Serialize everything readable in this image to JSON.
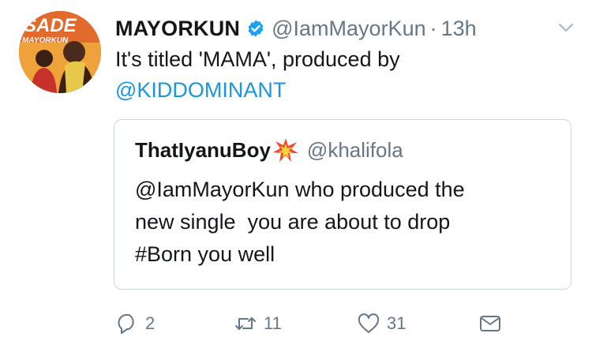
{
  "tweet": {
    "author_name": "MAYORKUN",
    "author_handle": "@IamMayorKun",
    "time": "13h",
    "text_before": "It's titled 'MAMA', produced by",
    "mention": "@KIDDOMINANT"
  },
  "quoted_tweet": {
    "author_name": "ThatIyanuBoy",
    "author_handle": "@khalifola",
    "text": "@IamMayorKun who produced the\nnew single  you are about to drop\n#Born you well"
  },
  "actions": {
    "reply_count": "2",
    "retweet_count": "11",
    "like_count": "31"
  },
  "avatar_text": {
    "title": "SADE",
    "artist": "MAYORKUN"
  },
  "colors": {
    "link": "#1b95e0",
    "secondary": "#657786",
    "border": "#ccd6dd",
    "verified": "#1da1f2"
  },
  "icons": [
    "verified-badge-icon",
    "chevron-down-icon",
    "collision-emoji-icon",
    "reply-icon",
    "retweet-icon",
    "like-icon",
    "direct-message-icon"
  ]
}
